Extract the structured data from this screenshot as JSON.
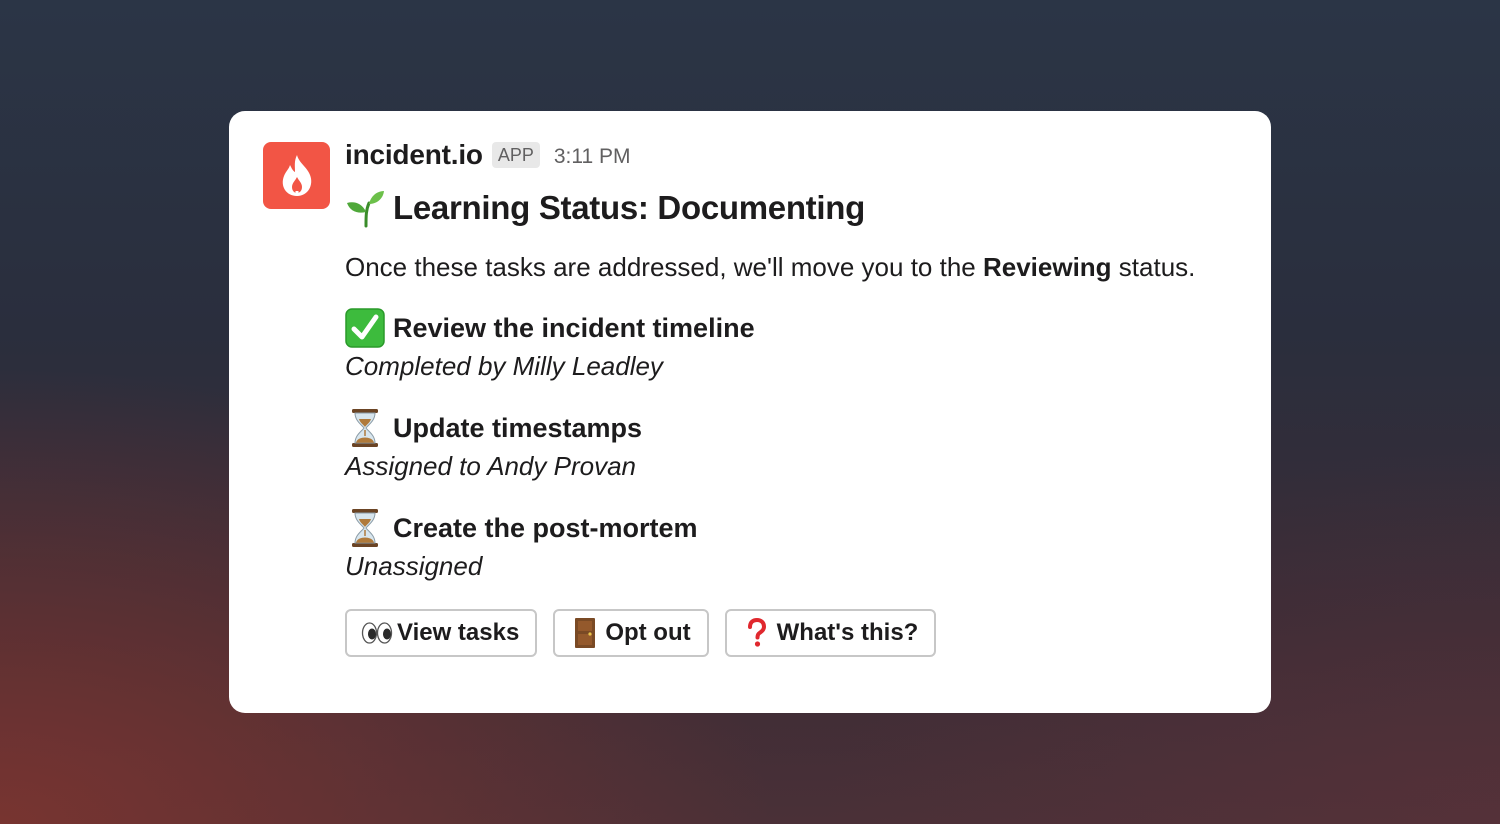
{
  "message": {
    "app_name": "incident.io",
    "app_badge": "APP",
    "timestamp": "3:11 PM",
    "title": "Learning Status: Documenting",
    "description_before": "Once these tasks are addressed, we'll move you to the ",
    "description_bold": "Reviewing",
    "description_after": " status.",
    "tasks": [
      {
        "icon": "check-mark-icon",
        "title": "Review the incident timeline",
        "subtitle": "Completed by Milly Leadley"
      },
      {
        "icon": "hourglass-icon",
        "title": "Update timestamps",
        "subtitle": "Assigned to Andy Provan"
      },
      {
        "icon": "hourglass-icon",
        "title": "Create the post-mortem",
        "subtitle": "Unassigned"
      }
    ],
    "buttons": [
      {
        "icon": "eyes-icon",
        "label": "View tasks"
      },
      {
        "icon": "door-icon",
        "label": "Opt out"
      },
      {
        "icon": "question-mark-icon",
        "label": "What's this?"
      }
    ]
  },
  "colors": {
    "avatar": "#f25545",
    "check_green": "#3dbb3d",
    "question_red": "#e0282e"
  }
}
